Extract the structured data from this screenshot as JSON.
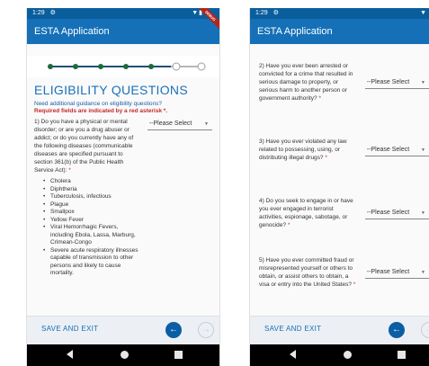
{
  "status": {
    "time": "1:29",
    "debug": "DEBUG"
  },
  "app": {
    "title": "ESTA Application"
  },
  "screen1": {
    "heading": "ELIGIBILITY QUESTIONS",
    "guidance_link": "Need additional guidance on eligibility questions?",
    "required_note": "Required fields are indicated by a red asterisk *.",
    "question1": "1) Do you have a physical or mental disorder; or are you a drug abuser or addict; or do you currently have any of the following diseases (communicable diseases are specified pursuant to section 361(b) of the Public Health Service Act):",
    "select_placeholder": "--Please Select",
    "diseases": [
      "Cholera",
      "Diphtheria",
      "Tuberculosis, infectious",
      "Plague",
      "Smallpox",
      "Yellow Fever",
      "Viral Hemorrhagic Fevers, including Ebola, Lassa, Marburg, Crimean-Congo",
      "Severe acute respiratory illnesses capable of transmission to other persons and likely to cause mortality."
    ]
  },
  "screen2": {
    "questions": [
      {
        "text": "2) Have you ever been arrested or convicted for a crime that resulted in serious damage to property, or serious harm to another person or government authority?",
        "select": "--Please Select"
      },
      {
        "text": "3) Have you ever violated any law related to possessing, using, or distributing illegal drugs?",
        "select": "--Please Select"
      },
      {
        "text": "4) Do you seek to engage in or have you ever engaged in terrorist activities, espionage, sabotage, or genocide?",
        "select": "--Please Select"
      },
      {
        "text": "5) Have you ever committed fraud or misrepresented yourself or others to obtain, or assist others to obtain, a visa or entry into the United States?",
        "select": "--Please Select"
      }
    ]
  },
  "bottom": {
    "save_exit": "SAVE AND EXIT"
  },
  "progress": {
    "completed_steps": 5,
    "total_steps": 7
  },
  "colors": {
    "app_bar": "#1570b8",
    "status_bar": "#0a5e9c",
    "accent": "#1b71b9",
    "required": "#c62828",
    "step_done": "#1f6a3a"
  }
}
